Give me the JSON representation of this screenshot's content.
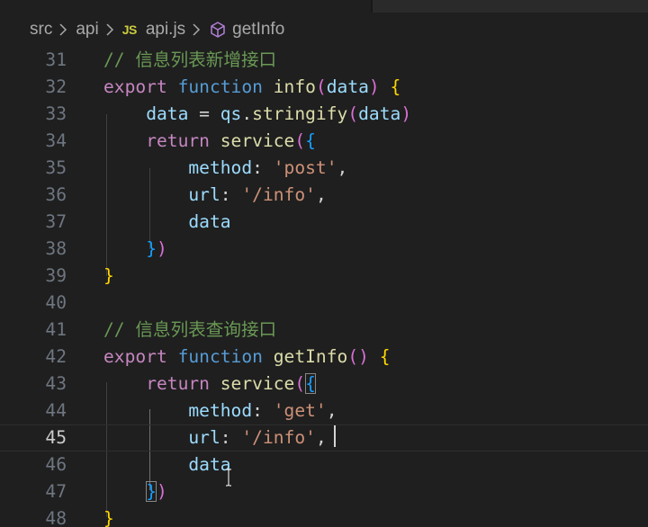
{
  "breadcrumb": {
    "items": [
      "src",
      "api",
      "api.js",
      "getInfo"
    ],
    "file_badge": "JS"
  },
  "editor": {
    "current_line": 45,
    "lines": [
      {
        "num": "31",
        "tokens": [
          {
            "t": "// 信息列表新增接口",
            "c": "c"
          }
        ]
      },
      {
        "num": "32",
        "tokens": [
          {
            "t": "export",
            "c": "kc"
          },
          {
            "t": " ",
            "c": "p"
          },
          {
            "t": "function",
            "c": "k"
          },
          {
            "t": " ",
            "c": "p"
          },
          {
            "t": "info",
            "c": "fn"
          },
          {
            "t": "(",
            "c": "b2"
          },
          {
            "t": "data",
            "c": "v"
          },
          {
            "t": ")",
            "c": "b2"
          },
          {
            "t": " ",
            "c": "p"
          },
          {
            "t": "{",
            "c": "b1"
          }
        ]
      },
      {
        "num": "33",
        "tokens": [
          {
            "t": "    ",
            "c": "p"
          },
          {
            "t": "data",
            "c": "v"
          },
          {
            "t": " = ",
            "c": "p"
          },
          {
            "t": "qs",
            "c": "v"
          },
          {
            "t": ".",
            "c": "p"
          },
          {
            "t": "stringify",
            "c": "fn"
          },
          {
            "t": "(",
            "c": "b2"
          },
          {
            "t": "data",
            "c": "v"
          },
          {
            "t": ")",
            "c": "b2"
          }
        ]
      },
      {
        "num": "34",
        "tokens": [
          {
            "t": "    ",
            "c": "p"
          },
          {
            "t": "return",
            "c": "kc"
          },
          {
            "t": " ",
            "c": "p"
          },
          {
            "t": "service",
            "c": "fn"
          },
          {
            "t": "(",
            "c": "b2"
          },
          {
            "t": "{",
            "c": "b3"
          }
        ]
      },
      {
        "num": "35",
        "tokens": [
          {
            "t": "        ",
            "c": "p"
          },
          {
            "t": "method",
            "c": "v"
          },
          {
            "t": ": ",
            "c": "p"
          },
          {
            "t": "'post'",
            "c": "s"
          },
          {
            "t": ",",
            "c": "p"
          }
        ]
      },
      {
        "num": "36",
        "tokens": [
          {
            "t": "        ",
            "c": "p"
          },
          {
            "t": "url",
            "c": "v"
          },
          {
            "t": ": ",
            "c": "p"
          },
          {
            "t": "'/info'",
            "c": "s"
          },
          {
            "t": ",",
            "c": "p"
          }
        ]
      },
      {
        "num": "37",
        "tokens": [
          {
            "t": "        ",
            "c": "p"
          },
          {
            "t": "data",
            "c": "v"
          }
        ]
      },
      {
        "num": "38",
        "tokens": [
          {
            "t": "    ",
            "c": "p"
          },
          {
            "t": "}",
            "c": "b3"
          },
          {
            "t": ")",
            "c": "b2"
          }
        ]
      },
      {
        "num": "39",
        "tokens": [
          {
            "t": "}",
            "c": "b1"
          }
        ]
      },
      {
        "num": "40",
        "tokens": []
      },
      {
        "num": "41",
        "tokens": [
          {
            "t": "// 信息列表查询接口",
            "c": "c"
          }
        ]
      },
      {
        "num": "42",
        "tokens": [
          {
            "t": "export",
            "c": "kc"
          },
          {
            "t": " ",
            "c": "p"
          },
          {
            "t": "function",
            "c": "k"
          },
          {
            "t": " ",
            "c": "p"
          },
          {
            "t": "getInfo",
            "c": "fn"
          },
          {
            "t": "()",
            "c": "b2"
          },
          {
            "t": " ",
            "c": "p"
          },
          {
            "t": "{",
            "c": "b1"
          }
        ]
      },
      {
        "num": "43",
        "tokens": [
          {
            "t": "    ",
            "c": "p"
          },
          {
            "t": "return",
            "c": "kc"
          },
          {
            "t": " ",
            "c": "p"
          },
          {
            "t": "service",
            "c": "fn"
          },
          {
            "t": "(",
            "c": "b2"
          },
          {
            "t": "{",
            "c": "b3",
            "m": 1
          }
        ]
      },
      {
        "num": "44",
        "tokens": [
          {
            "t": "        ",
            "c": "p"
          },
          {
            "t": "method",
            "c": "v"
          },
          {
            "t": ": ",
            "c": "p"
          },
          {
            "t": "'get'",
            "c": "s"
          },
          {
            "t": ",",
            "c": "p"
          }
        ]
      },
      {
        "num": "45",
        "tokens": [
          {
            "t": "        ",
            "c": "p"
          },
          {
            "t": "url",
            "c": "v"
          },
          {
            "t": ": ",
            "c": "p"
          },
          {
            "t": "'/info'",
            "c": "s"
          },
          {
            "t": ",",
            "c": "p"
          }
        ]
      },
      {
        "num": "46",
        "tokens": [
          {
            "t": "        ",
            "c": "p"
          },
          {
            "t": "data",
            "c": "v"
          }
        ]
      },
      {
        "num": "47",
        "tokens": [
          {
            "t": "    ",
            "c": "p"
          },
          {
            "t": "}",
            "c": "b3",
            "m": 1
          },
          {
            "t": ")",
            "c": "b2"
          }
        ]
      },
      {
        "num": "48",
        "tokens": [
          {
            "t": "}",
            "c": "b1"
          }
        ]
      }
    ]
  },
  "colors": {
    "background": "#1f1f1f",
    "comment": "#6a9955",
    "keyword": "#569cd6",
    "control_keyword": "#c586c0",
    "function": "#dcdcaa",
    "variable": "#9cdcfe",
    "string": "#ce9178",
    "bracket_1": "#ffd700",
    "bracket_2": "#da70d6",
    "bracket_3": "#179fff"
  },
  "icons": {
    "separator": "chevron-right-icon",
    "symbol": "cube-icon",
    "pointer": "text-cursor-icon"
  }
}
